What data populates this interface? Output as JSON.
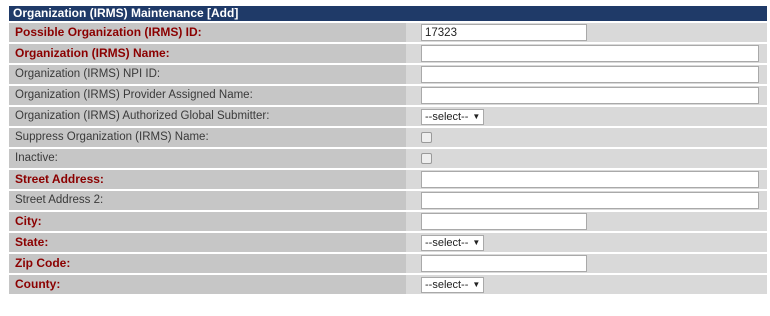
{
  "form_title": "Organization (IRMS) Maintenance [Add]",
  "fields": {
    "possible_id": {
      "label": "Possible Organization (IRMS) ID:",
      "value": "17323"
    },
    "org_name": {
      "label": "Organization (IRMS) Name:",
      "value": ""
    },
    "npi_id": {
      "label": "Organization (IRMS) NPI ID:",
      "value": ""
    },
    "provider_name": {
      "label": "Organization (IRMS) Provider Assigned Name:",
      "value": ""
    },
    "global_submitter": {
      "label": "Organization (IRMS) Authorized Global Submitter:",
      "selected": "--select--"
    },
    "suppress_name": {
      "label": "Suppress Organization (IRMS) Name:",
      "checked": false
    },
    "inactive": {
      "label": "Inactive:",
      "checked": false
    },
    "street_address": {
      "label": "Street Address:",
      "value": ""
    },
    "street_address_2": {
      "label": "Street Address 2:",
      "value": ""
    },
    "city": {
      "label": "City:",
      "value": ""
    },
    "state": {
      "label": "State:",
      "selected": "--select--"
    },
    "zip_code": {
      "label": "Zip Code:",
      "value": ""
    },
    "county": {
      "label": "County:",
      "selected": "--select--"
    }
  },
  "icons": {
    "dropdown": "chevron-down-icon",
    "checkbox": "checkbox-icon"
  },
  "colors": {
    "title_bar": "#1f3a68",
    "required_label": "#8b0000",
    "label_bg": "#c6c6c6"
  }
}
